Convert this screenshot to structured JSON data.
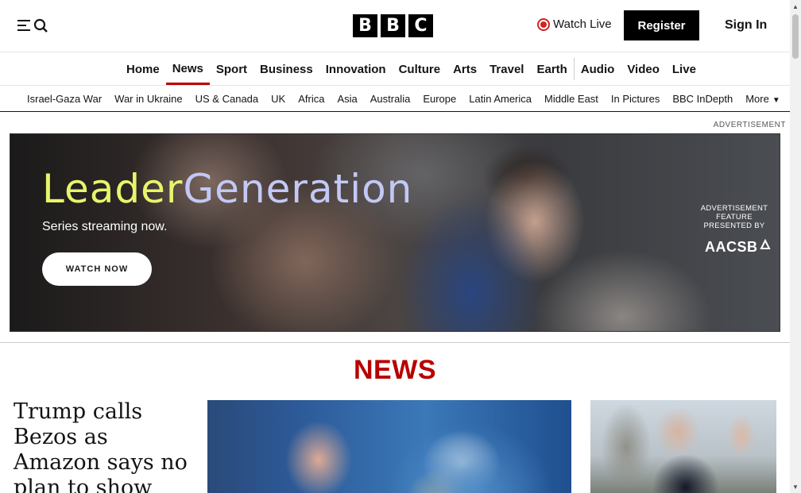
{
  "header": {
    "menu_icon": "menu-icon",
    "search_icon": "search-icon",
    "logo_letters": [
      "B",
      "B",
      "C"
    ],
    "watch_live_label": "Watch Live",
    "register_label": "Register",
    "sign_in_label": "Sign In"
  },
  "main_nav": {
    "items": [
      {
        "label": "Home"
      },
      {
        "label": "News",
        "active": true
      },
      {
        "label": "Sport"
      },
      {
        "label": "Business"
      },
      {
        "label": "Innovation"
      },
      {
        "label": "Culture"
      },
      {
        "label": "Arts"
      },
      {
        "label": "Travel"
      },
      {
        "label": "Earth"
      },
      {
        "label": "Audio"
      },
      {
        "label": "Video"
      },
      {
        "label": "Live"
      }
    ]
  },
  "sub_nav": {
    "items": [
      {
        "label": "Israel-Gaza War"
      },
      {
        "label": "War in Ukraine"
      },
      {
        "label": "US & Canada"
      },
      {
        "label": "UK"
      },
      {
        "label": "Africa"
      },
      {
        "label": "Asia"
      },
      {
        "label": "Australia"
      },
      {
        "label": "Europe"
      },
      {
        "label": "Latin America"
      },
      {
        "label": "Middle East"
      },
      {
        "label": "In Pictures"
      },
      {
        "label": "BBC InDepth"
      }
    ],
    "more_label": "More"
  },
  "advertisement": {
    "label": "ADVERTISEMENT",
    "title_part1": "Leader",
    "title_part2": "Generation",
    "subtitle": "Series streaming now.",
    "cta_label": "WATCH NOW",
    "feature_line1": "ADVERTISEMENT",
    "feature_line2": "FEATURE",
    "feature_line3": "PRESENTED BY",
    "brand": "AACSB"
  },
  "section": {
    "title": "NEWS"
  },
  "lead_story": {
    "headline": "Trump calls Bezos as Amazon says no plan to show"
  },
  "colors": {
    "brand_red": "#b80000",
    "live_red": "#d4231e",
    "ad_title_yellow": "#e8f56b",
    "ad_title_lavender": "#c3c8f5"
  }
}
